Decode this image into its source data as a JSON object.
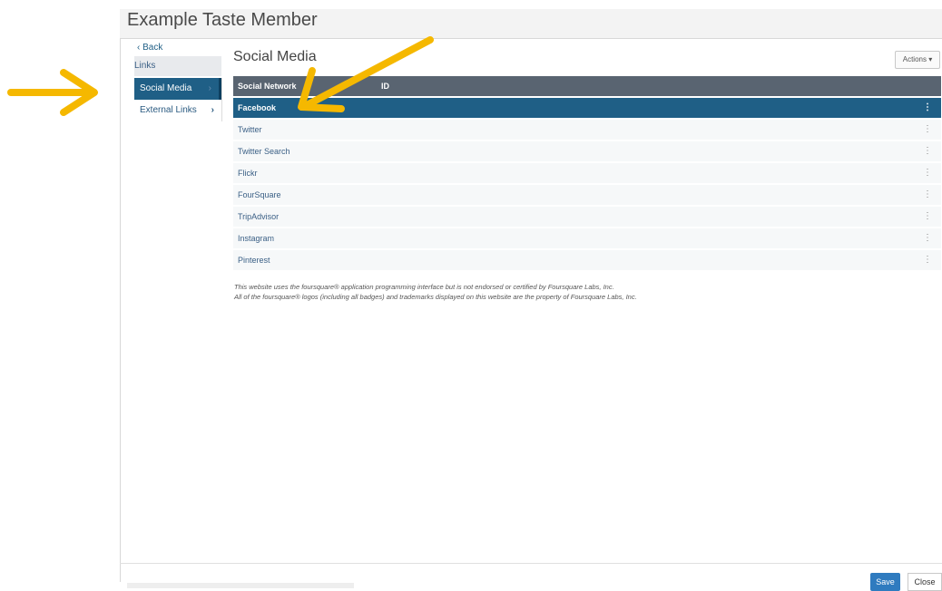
{
  "header": {
    "title": "Example Taste Member"
  },
  "sidebar": {
    "back_label": "‹ Back",
    "section_label": "Links",
    "items": [
      {
        "label": "Social Media",
        "chevron": "›"
      },
      {
        "label": "External Links",
        "chevron": "›"
      }
    ]
  },
  "main": {
    "title": "Social Media",
    "actions_label": "Actions ▾",
    "table": {
      "columns": [
        "Social Network",
        "ID"
      ],
      "rows": [
        {
          "name": "Facebook",
          "menu": "⋮"
        },
        {
          "name": "Twitter",
          "menu": "⋮"
        },
        {
          "name": "Twitter Search",
          "menu": "⋮"
        },
        {
          "name": "Flickr",
          "menu": "⋮"
        },
        {
          "name": "FourSquare",
          "menu": "⋮"
        },
        {
          "name": "TripAdvisor",
          "menu": "⋮"
        },
        {
          "name": "Instagram",
          "menu": "⋮"
        },
        {
          "name": "Pinterest",
          "menu": "⋮"
        }
      ]
    },
    "disclaimer": [
      "This website uses the foursquare® application programming interface but is not endorsed or certified by Foursquare Labs, Inc.",
      "All of the foursquare® logos (including all badges) and trademarks displayed on this website are the property of Foursquare Labs, Inc."
    ]
  },
  "footer": {
    "save_label": "Save",
    "close_label": "Close"
  },
  "colors": {
    "accent": "#1f5f86",
    "table_header": "#596471",
    "annotation_arrow": "#f5b800"
  },
  "icons": [
    "arrow-right-icon",
    "arrow-pointer-icon",
    "chevron-right-icon",
    "kebab-menu-icon",
    "caret-down-icon"
  ]
}
